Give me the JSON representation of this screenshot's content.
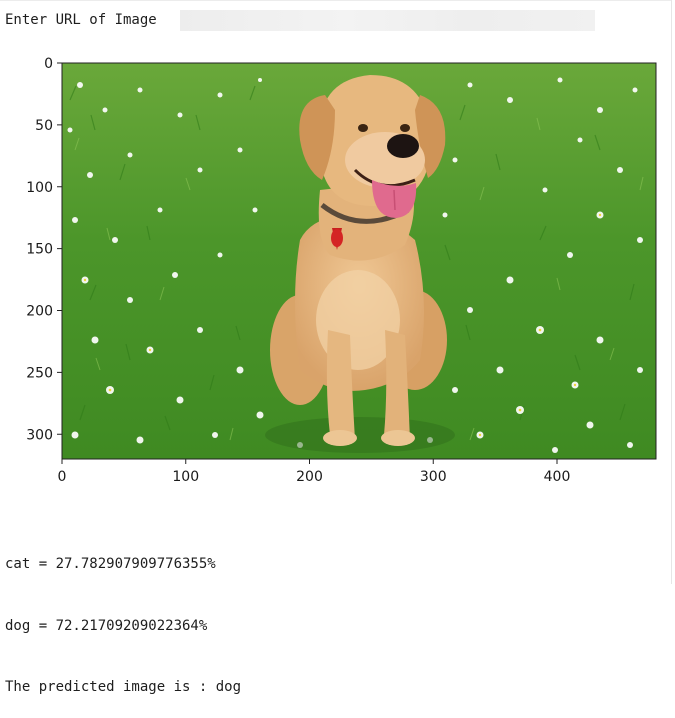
{
  "input": {
    "label": "Enter URL of Image",
    "value": "",
    "placeholder": ""
  },
  "figure": {
    "image_subject": "dog-photo",
    "chart_data": {
      "type": "image",
      "x_ticks": [
        0,
        100,
        200,
        300,
        400
      ],
      "y_ticks": [
        0,
        50,
        100,
        150,
        200,
        250,
        300
      ],
      "xlim": [
        0,
        480
      ],
      "ylim": [
        320,
        0
      ],
      "xlabel": "",
      "ylabel": "",
      "grid": false
    }
  },
  "output": {
    "line1": "cat = 27.782907909776355%",
    "line2": "dog = 72.21709209022364%",
    "line3": "The predicted image is : dog"
  },
  "colors": {
    "grass": "#4f9a2c",
    "dog_fur": "#e2b47f",
    "tongue": "#e06a8e"
  }
}
